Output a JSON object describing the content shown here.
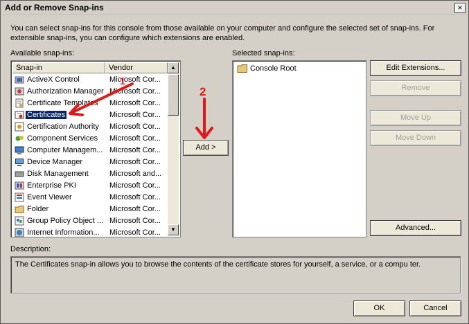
{
  "window": {
    "title": "Add or Remove Snap-ins",
    "close_glyph": "×",
    "intro": "You can select snap-ins for this console from those available on your computer and configure the selected set of snap-ins. For extensible snap-ins, you can configure which extensions are enabled."
  },
  "available": {
    "label": "Available snap-ins:",
    "columns": [
      "Snap-in",
      "Vendor"
    ],
    "items": [
      {
        "name": "ActiveX Control",
        "vendor": "Microsoft Cor...",
        "icon": "activex-icon"
      },
      {
        "name": "Authorization Manager",
        "vendor": "Microsoft Cor...",
        "icon": "authorization-manager-icon"
      },
      {
        "name": "Certificate Templates",
        "vendor": "Microsoft Cor...",
        "icon": "certificate-templates-icon"
      },
      {
        "name": "Certificates",
        "vendor": "Microsoft Cor...",
        "icon": "certificates-icon",
        "selected": true
      },
      {
        "name": "Certification Authority",
        "vendor": "Microsoft Cor...",
        "icon": "certification-authority-icon"
      },
      {
        "name": "Component Services",
        "vendor": "Microsoft Cor...",
        "icon": "component-services-icon"
      },
      {
        "name": "Computer Managem...",
        "vendor": "Microsoft Cor...",
        "icon": "computer-management-icon"
      },
      {
        "name": "Device Manager",
        "vendor": "Microsoft Cor...",
        "icon": "device-manager-icon"
      },
      {
        "name": "Disk Management",
        "vendor": "Microsoft and...",
        "icon": "disk-management-icon"
      },
      {
        "name": "Enterprise PKI",
        "vendor": "Microsoft Cor...",
        "icon": "enterprise-pki-icon"
      },
      {
        "name": "Event Viewer",
        "vendor": "Microsoft Cor...",
        "icon": "event-viewer-icon"
      },
      {
        "name": "Folder",
        "vendor": "Microsoft Cor...",
        "icon": "folder-icon"
      },
      {
        "name": "Group Policy Object ...",
        "vendor": "Microsoft Cor...",
        "icon": "group-policy-icon"
      },
      {
        "name": "Internet Information...",
        "vendor": "Microsoft Cor...",
        "icon": "iis-icon"
      }
    ]
  },
  "selected": {
    "label": "Selected snap-ins:",
    "items": [
      {
        "name": "Console Root",
        "icon": "folder-icon"
      }
    ]
  },
  "buttons": {
    "add": "Add >",
    "edit_extensions": "Edit Extensions...",
    "remove": "Remove",
    "move_up": "Move Up",
    "move_down": "Move Down",
    "advanced": "Advanced...",
    "ok": "OK",
    "cancel": "Cancel"
  },
  "description": {
    "label": "Description:",
    "text": "The Certificates snap-in allows you to browse the contents of the certificate stores for yourself, a service, or a compu  ter."
  },
  "annotations": {
    "step1": "1",
    "step2": "2",
    "color": "#e01a1a"
  }
}
